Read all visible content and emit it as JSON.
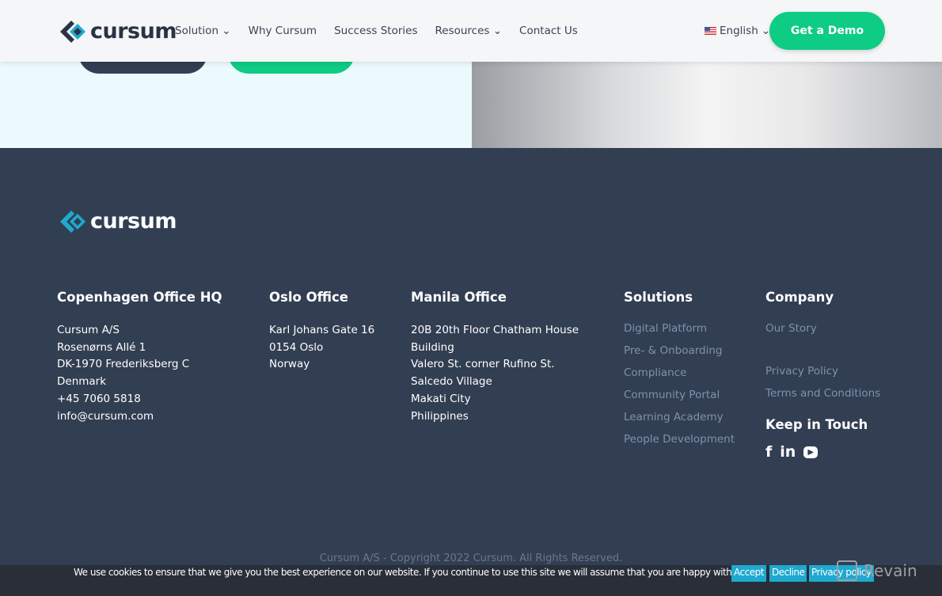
{
  "nav": {
    "logo": "cursum",
    "links": [
      "Solution",
      "Why Cursum",
      "Success Stories",
      "Resources",
      "Contact Us"
    ],
    "language": "English",
    "demo": "Get a Demo"
  },
  "footer": {
    "logo": "cursum",
    "copenhagen": {
      "title": "Copenhagen Office HQ",
      "lines": [
        "Cursum A/S",
        "Rosenørns Allé 1",
        "DK-1970 Frederiksberg C",
        "Denmark",
        "+45 7060 5818",
        "info@cursum.com"
      ]
    },
    "oslo": {
      "title": "Oslo Office",
      "lines": [
        "Karl Johans Gate 16",
        "0154 Oslo",
        "Norway"
      ]
    },
    "manila": {
      "title": "Manila Office",
      "lines": [
        "20B 20th Floor Chatham House",
        "Building",
        "Valero St. corner Rufino St.",
        "Salcedo Village",
        "Makati City",
        "Philippines"
      ]
    },
    "solutions": {
      "title": "Solutions",
      "links": [
        "Digital Platform",
        "Pre- & Onboarding",
        "Compliance",
        "Community Portal",
        "Learning Academy",
        "People Development"
      ]
    },
    "company": {
      "title": "Company",
      "links": [
        "Our Story",
        "Privacy Policy",
        "Terms and Conditions"
      ],
      "keep": "Keep in Touch"
    },
    "copyright": "Cursum A/S - Copyright 2022 Cursum. All Rights Reserved."
  },
  "cookie": {
    "message": "We use cookies to ensure that we give you the best experience on our website. If you continue to use this site we will assume that you are happy with it.",
    "accept": "Accept",
    "decline": "Decline",
    "privacy": "Privacy policy"
  },
  "watermark": "Revain",
  "colors": {
    "accent": "#0fcc85",
    "footer": "#323e52",
    "link": "#7d93ad"
  }
}
